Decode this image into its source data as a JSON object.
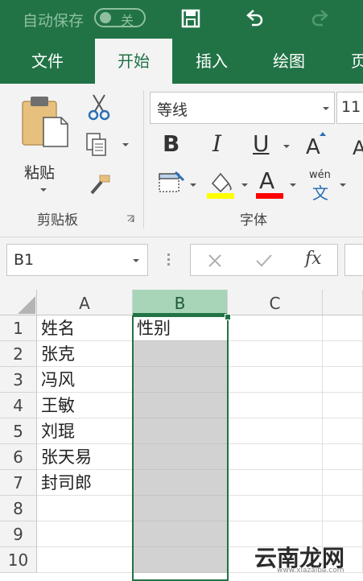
{
  "titlebar": {
    "autosave_label": "自动保存",
    "autosave_state": "关"
  },
  "tabs": [
    {
      "label": "文件",
      "active": false
    },
    {
      "label": "开始",
      "active": true
    },
    {
      "label": "插入",
      "active": false
    },
    {
      "label": "绘图",
      "active": false
    },
    {
      "label": "页",
      "active": false
    }
  ],
  "ribbon": {
    "clipboard": {
      "paste_label": "粘贴",
      "group_label": "剪贴板"
    },
    "font": {
      "font_name": "等线",
      "font_size": "11",
      "bold": "B",
      "italic": "I",
      "underline": "U",
      "grow": "A",
      "shrink": "A",
      "font_color_letter": "A",
      "phonetic_top": "wén",
      "phonetic_bottom": "文",
      "group_label": "字体",
      "highlight_color": "#ffff00",
      "font_color": "#ff0000"
    }
  },
  "formula_bar": {
    "name_box": "B1",
    "fx": "fx",
    "content": ""
  },
  "sheet": {
    "columns": [
      "A",
      "B",
      "C"
    ],
    "rows": [
      "1",
      "2",
      "3",
      "4",
      "5",
      "6",
      "7",
      "8",
      "9",
      "10"
    ],
    "col_a": [
      "姓名",
      "张克",
      "冯风",
      "王敏",
      "刘琨",
      "张天易",
      "封司郎",
      "",
      "",
      ""
    ],
    "col_b": [
      "性别",
      "",
      "",
      "",
      "",
      "",
      "",
      "",
      "",
      ""
    ],
    "selected_column": "B"
  },
  "watermark": {
    "main": "云南龙网",
    "sub": "www.xiazaiba.com"
  }
}
